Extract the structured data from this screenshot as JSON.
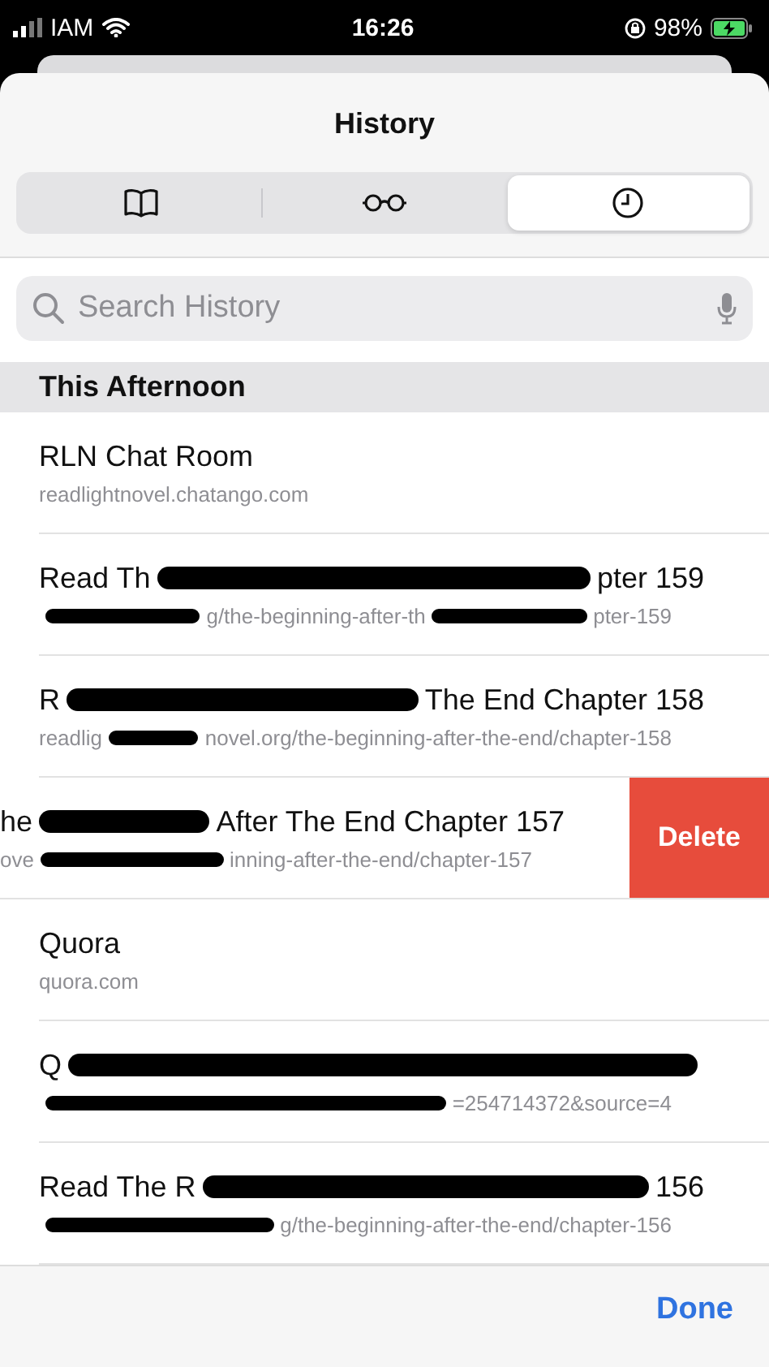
{
  "status_bar": {
    "carrier": "IAM",
    "time": "16:26",
    "battery": "98%"
  },
  "sheet": {
    "title": "History"
  },
  "tabs": [
    {
      "kind": "bookmarks",
      "selected": false
    },
    {
      "kind": "reading_list",
      "selected": false
    },
    {
      "kind": "history",
      "selected": true
    }
  ],
  "search": {
    "placeholder": "Search History"
  },
  "section": "This Afternoon",
  "rows": [
    {
      "title": {
        "parts": [
          "RLN Chat Room"
        ],
        "start_hidden": false
      },
      "url": {
        "parts": [
          "readlightnovel.chatango.com"
        ],
        "start_hidden": false
      },
      "swiped": false
    },
    {
      "title": {
        "parts": [
          "Read Th",
          "pter 159"
        ],
        "start_hidden": false
      },
      "url": {
        "parts": [
          "g/the-beginning-after-th",
          "pter-159"
        ],
        "start_hidden": true
      },
      "swiped": false
    },
    {
      "title": {
        "parts": [
          "R",
          "The End Chapter 158"
        ],
        "start_hidden": false
      },
      "url": {
        "parts": [
          "readlig",
          "novel.org/the-beginning-after-the-end/chapter-158"
        ],
        "start_hidden": false
      },
      "swiped": false
    },
    {
      "title": {
        "parts": [
          "he",
          "After The End Chapter 157"
        ],
        "start_hidden": false
      },
      "url": {
        "parts": [
          "ove",
          "inning-after-the-end/chapter-157"
        ],
        "start_hidden": false
      },
      "swiped": true,
      "swipe_action": "Delete"
    },
    {
      "title": {
        "parts": [
          "Quora"
        ],
        "start_hidden": false
      },
      "url": {
        "parts": [
          "quora.com"
        ],
        "start_hidden": false
      },
      "swiped": false
    },
    {
      "title": {
        "parts": [
          "Q"
        ],
        "start_hidden": false,
        "end_hidden": true
      },
      "url": {
        "parts": [
          "=254714372&source=4"
        ],
        "start_hidden": true
      },
      "swiped": false
    },
    {
      "title": {
        "parts": [
          "Read The R",
          "156"
        ],
        "start_hidden": false
      },
      "url": {
        "parts": [
          "g/the-beginning-after-the-end/chapter-156"
        ],
        "start_hidden": true
      },
      "swiped": false
    }
  ],
  "done": "Done"
}
